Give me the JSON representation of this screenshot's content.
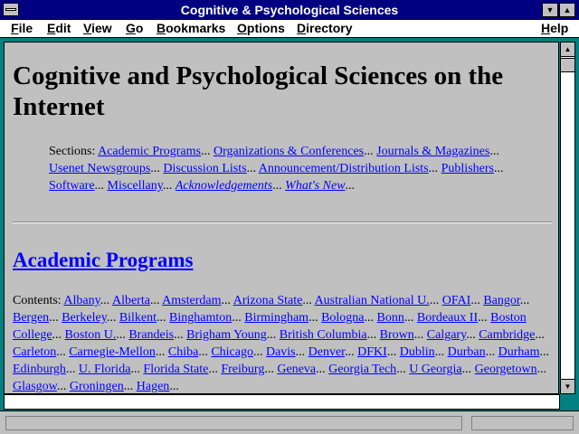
{
  "window": {
    "title": "Cognitive & Psychological Sciences"
  },
  "menu": [
    "File",
    "Edit",
    "View",
    "Go",
    "Bookmarks",
    "Options",
    "Directory",
    "Help"
  ],
  "page": {
    "heading": "Cognitive and Psychological Sciences on the Internet",
    "sections_label": "Sections:",
    "sections": [
      {
        "text": "Academic Programs",
        "italic": false
      },
      {
        "text": "Organizations & Conferences",
        "italic": false
      },
      {
        "text": "Journals & Magazines",
        "italic": false
      },
      {
        "text": "Usenet Newsgroups",
        "italic": false
      },
      {
        "text": "Discussion Lists",
        "italic": false
      },
      {
        "text": "Announcement/Distribution Lists",
        "italic": false
      },
      {
        "text": "Publishers",
        "italic": false
      },
      {
        "text": "Software",
        "italic": false
      },
      {
        "text": "Miscellany",
        "italic": false
      },
      {
        "text": "Acknowledgements",
        "italic": true
      },
      {
        "text": "What's New",
        "italic": true
      }
    ],
    "academic_heading": "Academic Programs",
    "contents_label": "Contents:",
    "contents": [
      "Albany",
      "Alberta",
      "Amsterdam",
      "Arizona State",
      "Australian National U.",
      "OFAI",
      "Bangor",
      "Bergen",
      "Berkeley",
      "Bilkent",
      "Binghamton",
      "Birmingham",
      "Bologna",
      "Bonn",
      "Bordeaux II",
      "Boston College",
      "Boston U.",
      "Brandeis",
      "Brigham Young",
      "British Columbia",
      "Brown",
      "Calgary",
      "Cambridge",
      "Carleton",
      "Carnegie-Mellon",
      "Chiba",
      "Chicago",
      "Davis",
      "Denver",
      "DFKI",
      "Dublin",
      "Durban",
      "Durham",
      "Edinburgh",
      "U. Florida",
      "Florida State",
      "Freiburg",
      "Geneva",
      "Georgia Tech",
      "U Georgia",
      "Georgetown",
      "Glasgow",
      "Groningen",
      "Hagen"
    ]
  },
  "status": {
    "text": ""
  }
}
